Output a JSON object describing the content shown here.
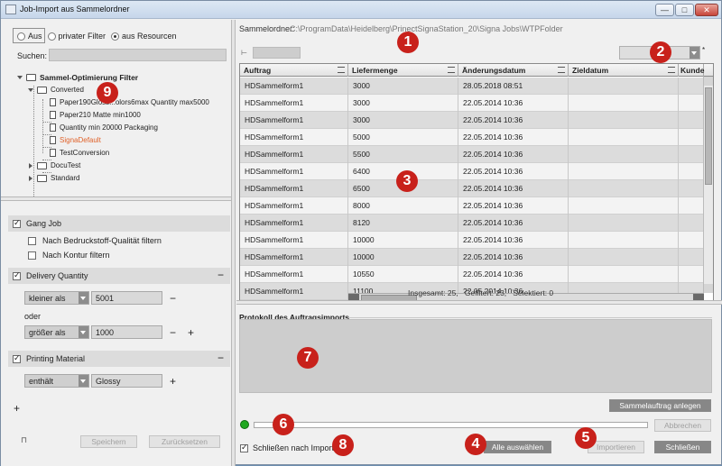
{
  "window": {
    "title": "Job-Import aus Sammelordner",
    "controls": {
      "minimize": "—",
      "maximize": "□",
      "close": "✕"
    }
  },
  "source": {
    "options": [
      "Aus",
      "privater Filter",
      "aus Resourcen"
    ],
    "selected": "aus Resourcen"
  },
  "search": {
    "label": "Suchen:",
    "value": ""
  },
  "tree": {
    "root": "Sammel-Optimierung Filter",
    "converted": "Converted",
    "items": [
      "Paper190Gloss...olors6max Quantity max5000",
      "Paper210 Matte min1000",
      "Quantity min 20000 Packaging",
      "SignaDefault",
      "TestConversion"
    ],
    "folders": [
      "DocuTest",
      "Standard"
    ]
  },
  "filters": {
    "gang_job": {
      "label": "Gang Job",
      "checked": true,
      "options": [
        {
          "label": "Nach Bedruckstoff-Qualität filtern",
          "checked": false
        },
        {
          "label": "Nach Kontur filtern",
          "checked": false
        }
      ]
    },
    "delivery_quantity": {
      "label": "Delivery Quantity",
      "checked": true,
      "cond1": {
        "op": "kleiner als",
        "value": "5001"
      },
      "or_label": "oder",
      "cond2": {
        "op": "größer als",
        "value": "1000"
      }
    },
    "printing_material": {
      "label": "Printing Material",
      "checked": true,
      "cond": {
        "op": "enthält",
        "value": "Glossy"
      }
    },
    "save_label": "Speichern",
    "reset_label": "Zurücksetzen"
  },
  "path": {
    "label": "Sammelordner:",
    "value": "C:\\ProgramData\\Heidelberg\\PrinectSignaStation_20\\Signa Jobs\\WTPFolder"
  },
  "table": {
    "columns": [
      "Auftrag",
      "Liefermenge",
      "Änderungsdatum",
      "Zieldatum",
      "Kunde"
    ],
    "rows": [
      [
        "HDSammelform1",
        "3000",
        "28.05.2018 08:51",
        "",
        ""
      ],
      [
        "HDSammelform1",
        "3000",
        "22.05.2014 10:36",
        "",
        ""
      ],
      [
        "HDSammelform1",
        "3000",
        "22.05.2014 10:36",
        "",
        ""
      ],
      [
        "HDSammelform1",
        "5000",
        "22.05.2014 10:36",
        "",
        ""
      ],
      [
        "HDSammelform1",
        "5500",
        "22.05.2014 10:36",
        "",
        ""
      ],
      [
        "HDSammelform1",
        "6400",
        "22.05.2014 10:36",
        "",
        ""
      ],
      [
        "HDSammelform1",
        "6500",
        "22.05.2014 10:36",
        "",
        ""
      ],
      [
        "HDSammelform1",
        "8000",
        "22.05.2014 10:36",
        "",
        ""
      ],
      [
        "HDSammelform1",
        "8120",
        "22.05.2014 10:36",
        "",
        ""
      ],
      [
        "HDSammelform1",
        "10000",
        "22.05.2014 10:36",
        "",
        ""
      ],
      [
        "HDSammelform1",
        "10000",
        "22.05.2014 10:36",
        "",
        ""
      ],
      [
        "HDSammelform1",
        "10550",
        "22.05.2014 10:36",
        "",
        ""
      ],
      [
        "HDSammelform1",
        "11100",
        "22.05.2014 10:36",
        "",
        ""
      ]
    ]
  },
  "stats": {
    "total": "Insgesamt: 25,",
    "filtered": "Gefiltert: 23,",
    "selected": "Selektiert: 0"
  },
  "protocol": {
    "title": "Protokoll des Auftragsimports"
  },
  "buttons": {
    "create": "Sammelauftrag anlegen",
    "cancel": "Abbrechen",
    "select_all": "Alle auswählen",
    "import": "Importieren",
    "close": "Schließen"
  },
  "close_after_import": {
    "label": "Schließen nach Import",
    "checked": true
  },
  "markers": [
    "1",
    "2",
    "3",
    "4",
    "5",
    "6",
    "7",
    "8",
    "9"
  ],
  "colors": {
    "marker": "#c8211b",
    "selected_tree_item": "#e0622a",
    "status_led": "#1fa81f"
  }
}
